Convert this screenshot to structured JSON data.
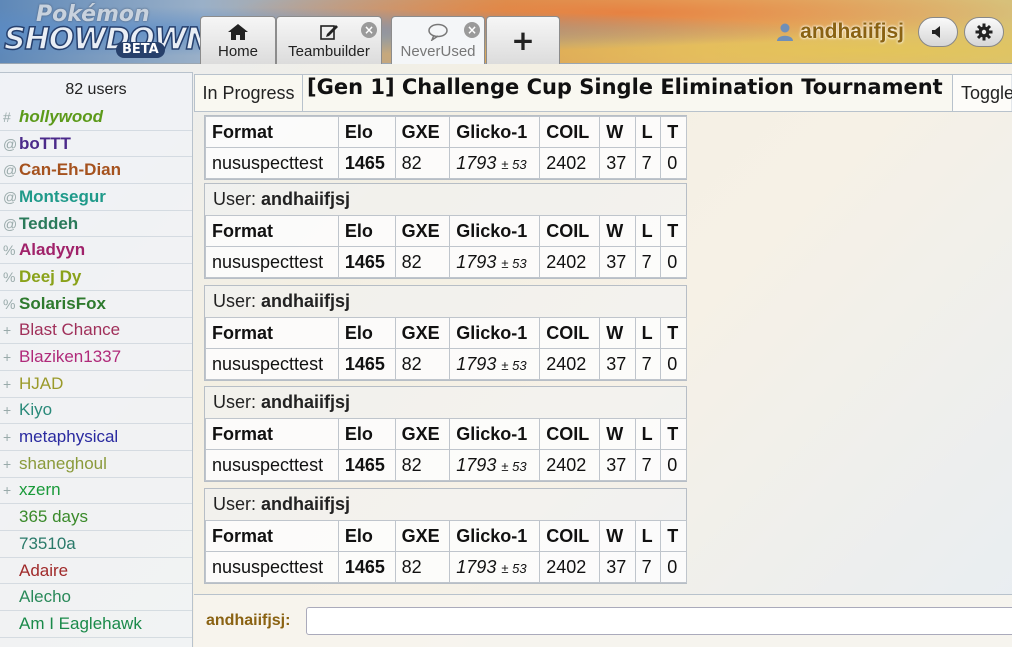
{
  "header": {
    "logo": {
      "top": "Pokémon",
      "main": "SHOWDOWN",
      "beta": "BETA"
    },
    "tabs": [
      {
        "label": "Home",
        "icon": "home-icon"
      },
      {
        "label": "Teambuilder",
        "icon": "edit-icon"
      },
      {
        "label": "NeverUsed",
        "icon": "chat-bubble-icon"
      },
      {
        "label": "+",
        "icon": "plus-icon"
      }
    ],
    "username": "andhaiifjsj"
  },
  "userlist": {
    "count_text": "82 users",
    "users": [
      {
        "rank": "#",
        "name": "hollywood",
        "color": "#5c9a1a",
        "bold": true,
        "italic": true
      },
      {
        "rank": "@",
        "name": "boTTT",
        "color": "#4b2a8a",
        "bold": true,
        "italic": false
      },
      {
        "rank": "@",
        "name": "Can-Eh-Dian",
        "color": "#a5521e",
        "bold": true,
        "italic": false
      },
      {
        "rank": "@",
        "name": "Montsegur",
        "color": "#1f9a8a",
        "bold": true,
        "italic": false
      },
      {
        "rank": "@",
        "name": "Teddeh",
        "color": "#2a7a5a",
        "bold": true,
        "italic": false
      },
      {
        "rank": "%",
        "name": "Aladyyn",
        "color": "#a0226a",
        "bold": true,
        "italic": false
      },
      {
        "rank": "%",
        "name": "Deej Dy",
        "color": "#8aa21a",
        "bold": true,
        "italic": false
      },
      {
        "rank": "%",
        "name": "SolarisFox",
        "color": "#2e7a2e",
        "bold": true,
        "italic": false
      },
      {
        "rank": "+",
        "name": "Blast Chance",
        "color": "#a0305a",
        "bold": false,
        "italic": false
      },
      {
        "rank": "+",
        "name": "Blaziken1337",
        "color": "#b02a7a",
        "bold": false,
        "italic": false
      },
      {
        "rank": "+",
        "name": "HJAD",
        "color": "#9a9a2a",
        "bold": false,
        "italic": false
      },
      {
        "rank": "+",
        "name": "Kiyo",
        "color": "#2a8a7a",
        "bold": false,
        "italic": false
      },
      {
        "rank": "+",
        "name": "metaphysical",
        "color": "#2a2aa0",
        "bold": false,
        "italic": false
      },
      {
        "rank": "+",
        "name": "shaneghoul",
        "color": "#8a9a3a",
        "bold": false,
        "italic": false
      },
      {
        "rank": "+",
        "name": "xzern",
        "color": "#1a9a3a",
        "bold": false,
        "italic": false
      },
      {
        "rank": "",
        "name": "365 days",
        "color": "#3a8a2a",
        "bold": false,
        "italic": false
      },
      {
        "rank": "",
        "name": "73510a",
        "color": "#2a7a6a",
        "bold": false,
        "italic": false
      },
      {
        "rank": "",
        "name": "Adaire",
        "color": "#a02a2a",
        "bold": false,
        "italic": false
      },
      {
        "rank": "",
        "name": "Alecho",
        "color": "#2a8a5a",
        "bold": false,
        "italic": false
      },
      {
        "rank": "",
        "name": "Am I Eaglehawk",
        "color": "#1a8a4a",
        "bold": false,
        "italic": false
      }
    ]
  },
  "tourbar": {
    "status": "In Progress",
    "title": "[Gen 1] Challenge Cup Single Elimination Tournament",
    "toggle": "Toggle"
  },
  "ladder": {
    "columns": [
      "Format",
      "Elo",
      "GXE",
      "Glicko-1",
      "COIL",
      "W",
      "L",
      "T"
    ],
    "blocks": [
      {
        "user_label": "",
        "user": "",
        "row": {
          "format": "nususpecttest",
          "elo": "1465",
          "gxe": "82",
          "glicko": "1793",
          "glicko_dev": "± 53",
          "coil": "2402",
          "w": "37",
          "l": "7",
          "t": "0"
        }
      },
      {
        "user_label": "User:",
        "user": "andhaiifjsj",
        "row": {
          "format": "nususpecttest",
          "elo": "1465",
          "gxe": "82",
          "glicko": "1793",
          "glicko_dev": "± 53",
          "coil": "2402",
          "w": "37",
          "l": "7",
          "t": "0"
        }
      },
      {
        "user_label": "User:",
        "user": "andhaiifjsj",
        "row": {
          "format": "nususpecttest",
          "elo": "1465",
          "gxe": "82",
          "glicko": "1793",
          "glicko_dev": "± 53",
          "coil": "2402",
          "w": "37",
          "l": "7",
          "t": "0"
        }
      },
      {
        "user_label": "User:",
        "user": "andhaiifjsj",
        "row": {
          "format": "nususpecttest",
          "elo": "1465",
          "gxe": "82",
          "glicko": "1793",
          "glicko_dev": "± 53",
          "coil": "2402",
          "w": "37",
          "l": "7",
          "t": "0"
        }
      },
      {
        "user_label": "User:",
        "user": "andhaiifjsj",
        "row": {
          "format": "nususpecttest",
          "elo": "1465",
          "gxe": "82",
          "glicko": "1793",
          "glicko_dev": "± 53",
          "coil": "2402",
          "w": "37",
          "l": "7",
          "t": "0"
        }
      }
    ]
  },
  "chat": {
    "label": "andhaiifjsj:",
    "input_value": ""
  }
}
